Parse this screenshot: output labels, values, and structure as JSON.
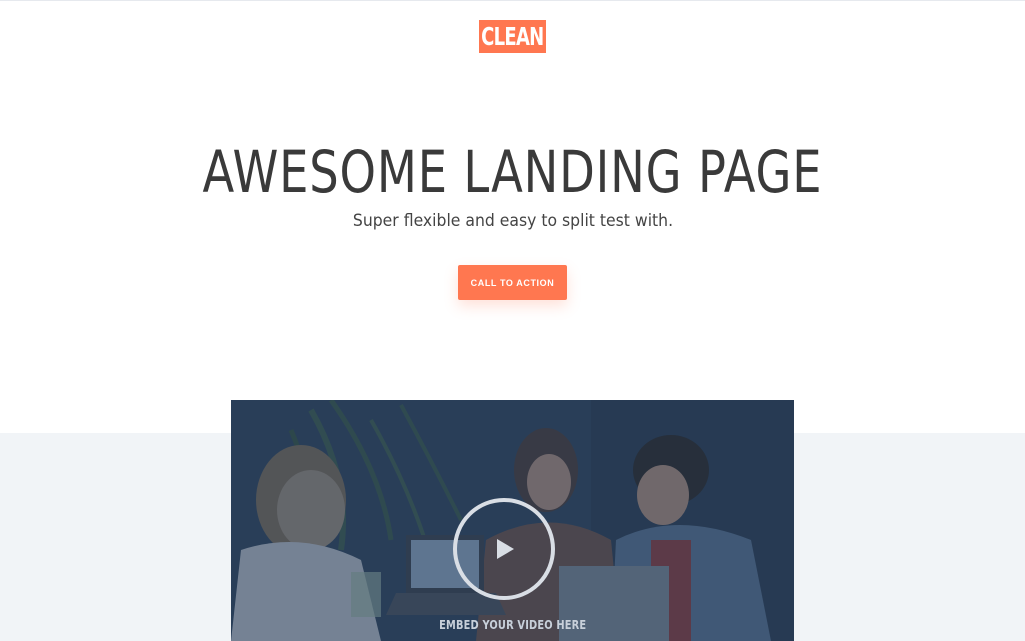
{
  "brand": {
    "logo_text": "CLEAN",
    "accent_color": "#ff7750"
  },
  "hero": {
    "headline": "AWESOME LANDING PAGE",
    "subheadline": "Super flexible and easy to split test with.",
    "cta_label": "CALL TO ACTION"
  },
  "video": {
    "caption": "EMBED YOUR VIDEO HERE",
    "play_icon": "play-icon"
  },
  "colors": {
    "text_dark": "#3a3a3a",
    "band_background": "#f1f4f7",
    "video_overlay": "#243c5c"
  }
}
